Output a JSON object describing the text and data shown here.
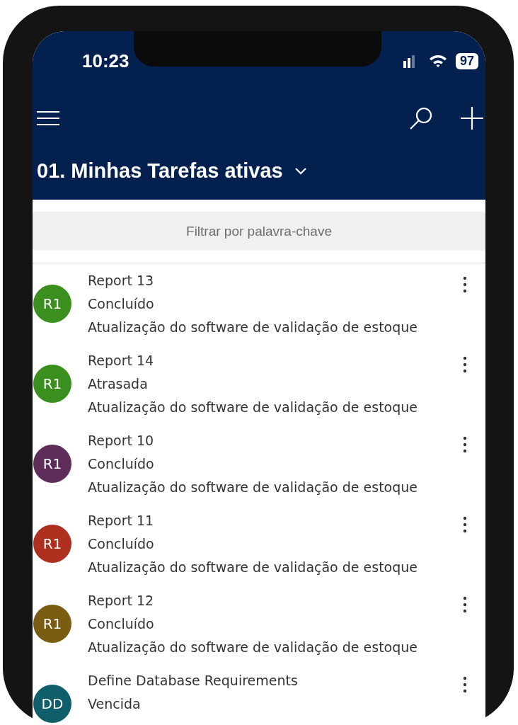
{
  "status_bar": {
    "time": "10:23",
    "battery": "97"
  },
  "header": {
    "title": "01. Minhas Tarefas ativas"
  },
  "filter": {
    "placeholder": "Filtrar por palavra-chave"
  },
  "tasks": [
    {
      "initials": "R1",
      "color": "#3a8f1e",
      "title": "Report 13",
      "status": "Concluído",
      "description": "Atualização do software de validação de estoque"
    },
    {
      "initials": "R1",
      "color": "#3a8f1e",
      "title": "Report 14",
      "status": "Atrasada",
      "description": "Atualização do software de validação de estoque"
    },
    {
      "initials": "R1",
      "color": "#5e2d5a",
      "title": "Report 10",
      "status": "Concluído",
      "description": "Atualização do software de validação de estoque"
    },
    {
      "initials": "R1",
      "color": "#b0301f",
      "title": "Report 11",
      "status": "Concluído",
      "description": "Atualização do software de validação de estoque"
    },
    {
      "initials": "R1",
      "color": "#7a5d12",
      "title": "Report 12",
      "status": "Concluído",
      "description": "Atualização do software de validação de estoque"
    },
    {
      "initials": "DD",
      "color": "#0f5f6b",
      "title": "Define Database Requirements",
      "status": "Vencida"
    }
  ]
}
